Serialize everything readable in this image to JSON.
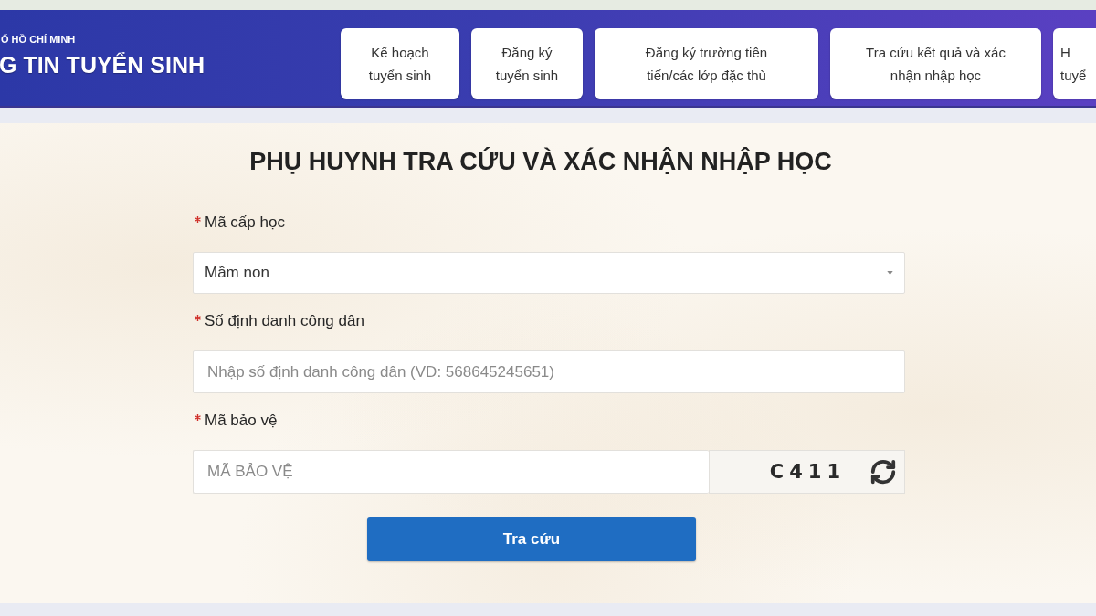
{
  "header": {
    "subtitle": "Ố HỒ CHÍ MINH",
    "title": "G TIN TUYỂN SINH",
    "nav": [
      {
        "label": "Kế hoạch\ntuyển sinh"
      },
      {
        "label": "Đăng ký\ntuyển sinh"
      },
      {
        "label": "Đăng ký trường tiên\ntiến/các lớp đặc thù"
      },
      {
        "label": "Tra cứu kết quả và xác\nnhận nhập học"
      },
      {
        "label": "H\ntuyể"
      }
    ]
  },
  "page_title": "PHỤ HUYNH TRA CỨU VÀ XÁC NHẬN NHẬP HỌC",
  "form": {
    "fields": [
      {
        "kind": "select",
        "label": "Mã cấp học",
        "required": true,
        "value": "Mầm non"
      },
      {
        "kind": "text",
        "label": "Số định danh công dân",
        "required": true,
        "placeholder": "Nhập số định danh công dân (VD: 568645245651)"
      },
      {
        "kind": "captcha",
        "label": "Mã bảo vệ",
        "required": true,
        "placeholder": "MÃ BẢO VỆ",
        "captcha": "C411"
      }
    ],
    "submit": "Tra cứu"
  }
}
